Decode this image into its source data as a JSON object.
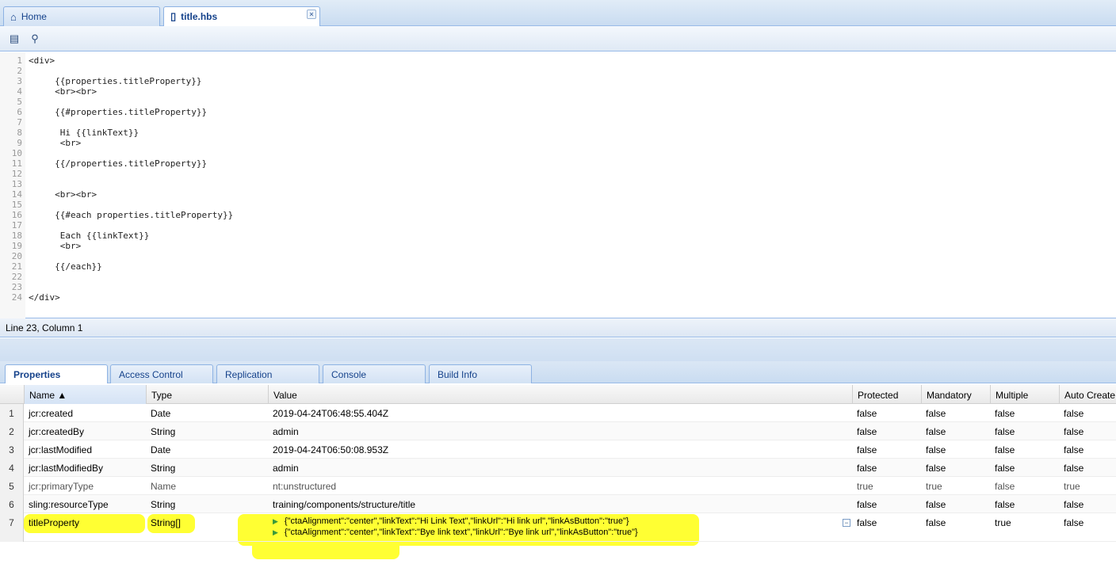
{
  "tabs": [
    {
      "label": "Home",
      "icon": "home-icon"
    },
    {
      "label": "title.hbs",
      "icon": "file-icon",
      "close": "×"
    }
  ],
  "toolbar": {
    "save_icon": "▤",
    "find_icon": "⚲"
  },
  "editor": {
    "lines": [
      {
        "n": "1",
        "text": "<div>"
      },
      {
        "n": "2",
        "text": ""
      },
      {
        "n": "3",
        "text": "     {{properties.titleProperty}}"
      },
      {
        "n": "4",
        "text": "     <br><br>"
      },
      {
        "n": "5",
        "text": ""
      },
      {
        "n": "6",
        "text": "     {{#properties.titleProperty}}"
      },
      {
        "n": "7",
        "text": ""
      },
      {
        "n": "8",
        "text": "      Hi {{linkText}}"
      },
      {
        "n": "9",
        "text": "      <br>"
      },
      {
        "n": "10",
        "text": ""
      },
      {
        "n": "11",
        "text": "     {{/properties.titleProperty}}"
      },
      {
        "n": "12",
        "text": ""
      },
      {
        "n": "13",
        "text": ""
      },
      {
        "n": "14",
        "text": "     <br><br>"
      },
      {
        "n": "15",
        "text": ""
      },
      {
        "n": "16",
        "text": "     {{#each properties.titleProperty}}"
      },
      {
        "n": "17",
        "text": ""
      },
      {
        "n": "18",
        "text": "      Each {{linkText}}"
      },
      {
        "n": "19",
        "text": "      <br>"
      },
      {
        "n": "20",
        "text": ""
      },
      {
        "n": "21",
        "text": "     {{/each}}"
      },
      {
        "n": "22",
        "text": ""
      },
      {
        "n": "23",
        "text": ""
      },
      {
        "n": "24",
        "text": "</div>"
      }
    ]
  },
  "status": {
    "text": "Line 23, Column 1"
  },
  "bottom_tabs": [
    "Properties",
    "Access Control",
    "Replication",
    "Console",
    "Build Info"
  ],
  "grid": {
    "columns": [
      "",
      "Name ▲",
      "Type",
      "Value",
      "Protected",
      "Mandatory",
      "Multiple",
      "Auto Create"
    ],
    "rows": [
      {
        "n": "1",
        "name": "jcr:created",
        "type": "Date",
        "value": "2019-04-24T06:48:55.404Z",
        "protected": "false",
        "mandatory": "false",
        "multiple": "false",
        "auto": "false"
      },
      {
        "n": "2",
        "name": "jcr:createdBy",
        "type": "String",
        "value": "admin",
        "protected": "false",
        "mandatory": "false",
        "multiple": "false",
        "auto": "false"
      },
      {
        "n": "3",
        "name": "jcr:lastModified",
        "type": "Date",
        "value": "2019-04-24T06:50:08.953Z",
        "protected": "false",
        "mandatory": "false",
        "multiple": "false",
        "auto": "false"
      },
      {
        "n": "4",
        "name": "jcr:lastModifiedBy",
        "type": "String",
        "value": "admin",
        "protected": "false",
        "mandatory": "false",
        "multiple": "false",
        "auto": "false"
      },
      {
        "n": "5",
        "name": "jcr:primaryType",
        "type": "Name",
        "value": "nt:unstructured",
        "protected": "true",
        "mandatory": "true",
        "multiple": "false",
        "auto": "true"
      },
      {
        "n": "6",
        "name": "sling:resourceType",
        "type": "String",
        "value": "training/components/structure/title",
        "protected": "false",
        "mandatory": "false",
        "multiple": "false",
        "auto": "false"
      },
      {
        "n": "7",
        "name": "titleProperty",
        "type": "String[]",
        "values": [
          "{\"ctaAlignment\":\"center\",\"linkText\":\"Hi Link Text\",\"linkUrl\":\"Hi link url\",\"linkAsButton\":\"true\"}",
          "{\"ctaAlignment\":\"center\",\"linkText\":\"Bye link text\",\"linkUrl\":\"Bye link url\",\"linkAsButton\":\"true\"}"
        ],
        "protected": "false",
        "mandatory": "false",
        "multiple": "true",
        "auto": "false",
        "collapse": "−"
      }
    ]
  },
  "colors": {
    "highlight": "#ffff33",
    "accent": "#15428b",
    "border": "#99bbe8"
  }
}
